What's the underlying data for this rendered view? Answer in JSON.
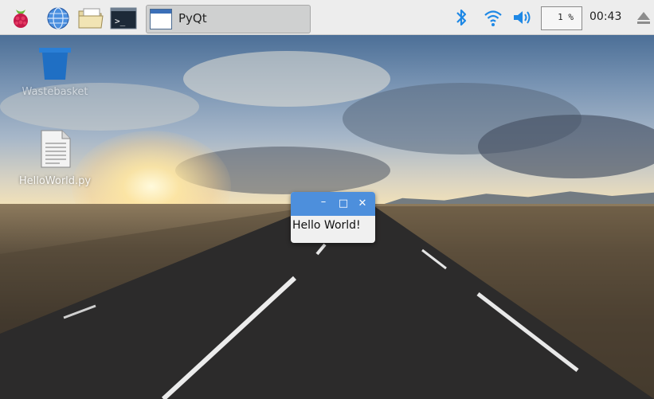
{
  "taskbar": {
    "launchers": [
      {
        "name": "menu",
        "icon": "raspberry-icon"
      },
      {
        "name": "browser",
        "icon": "globe-icon"
      },
      {
        "name": "file-manager",
        "icon": "folder-icon"
      },
      {
        "name": "terminal",
        "icon": "terminal-icon"
      }
    ],
    "terminal_glyph": ">_",
    "task_button_label": "PyQt",
    "tray": {
      "bluetooth_icon": "bluetooth-icon",
      "wifi_icon": "wifi-icon",
      "volume_icon": "volume-icon",
      "cpu_label": "1 %",
      "clock": "00:43",
      "eject_icon": "eject-icon"
    }
  },
  "desktop": {
    "icons": [
      {
        "label": "Wastebasket",
        "icon": "trash-icon"
      },
      {
        "label": "HelloWorld.py",
        "icon": "text-file-icon"
      }
    ]
  },
  "window": {
    "title": "",
    "minimize": "–",
    "maximize": "□",
    "close": "✕",
    "content_label": "Hello World!"
  },
  "colors": {
    "titlebar": "#4d8fdc",
    "taskbar": "#ededed",
    "raspberry": "#c51a4a",
    "accent_blue": "#1e88e5"
  }
}
